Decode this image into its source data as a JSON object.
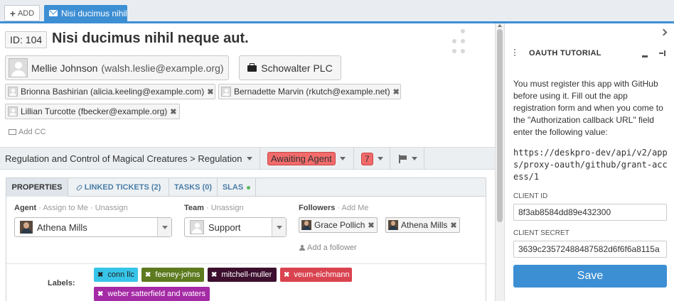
{
  "topbar": {
    "add_label": "ADD",
    "tab_title": "Nisi ducimus nihil neque aut."
  },
  "ticket": {
    "id_label": "ID: 104",
    "title": "Nisi ducimus nihil neque aut.",
    "person_name": "Mellie Johnson",
    "person_email": "(walsh.leslie@example.org)",
    "organization": "Schowalter PLC",
    "cc": [
      {
        "name": "Brionna Bashirian (alicia.keeling@example.com)"
      },
      {
        "name": "Bernadette Marvin (rkutch@example.net)"
      },
      {
        "name": "Lillian Turcotte (fbecker@example.org)"
      }
    ],
    "add_cc_label": "Add CC"
  },
  "properties_bar": {
    "category": "Regulation and Control of Magical Creatures > Regulation",
    "status": "Awaiting Agent",
    "urgency": "7"
  },
  "tabs": [
    {
      "label": "PROPERTIES"
    },
    {
      "label": "LINKED TICKETS (2)"
    },
    {
      "label": "TASKS (0)"
    },
    {
      "label": "SLAS"
    }
  ],
  "properties": {
    "agent_label": "Agent",
    "agent_assign_to_me": "· Assign to Me",
    "agent_unassign": "· Unassign",
    "agent_value": "Athena Mills",
    "team_label": "Team",
    "team_unassign": "· Unassign",
    "team_value": "Support",
    "followers_label": "Followers",
    "followers_add_me": "· Add Me",
    "followers": [
      {
        "name": "Grace Pollich"
      },
      {
        "name": "Athena Mills"
      }
    ],
    "add_follower_label": "Add a follower",
    "labels_label": "Labels:",
    "labels": [
      {
        "text": "conn llc",
        "bg": "#36c5e8",
        "fg": "#222"
      },
      {
        "text": "feeney-johns",
        "bg": "#5d7a1f",
        "fg": "#fff"
      },
      {
        "text": "mitchell-muller",
        "bg": "#3d0f2e",
        "fg": "#fff"
      },
      {
        "text": "veum-eichmann",
        "bg": "#d9434f",
        "fg": "#fff"
      },
      {
        "text": "weber satterfield and waters",
        "bg": "#a52aa5",
        "fg": "#fff"
      }
    ]
  },
  "sidebar": {
    "title": "OAUTH TUTORIAL",
    "instructions": "You must register this app with GitHub before using it. Fill out the app registration form and when you come to the \"Authorization callback URL\" field enter the following value:",
    "callback_url": "https://deskpro-dev/api/v2/apps/proxy-oauth/github/grant-access/1",
    "client_id_label": "CLIENT ID",
    "client_id_value": "8f3ab8584dd89e432300",
    "client_secret_label": "CLIENT SECRET",
    "client_secret_value": "3639c23572488487582d6f6f6a8115a",
    "save_label": "Save"
  },
  "colors": {
    "accent": "#3d8fd4",
    "status_red": "#f26b6b"
  }
}
